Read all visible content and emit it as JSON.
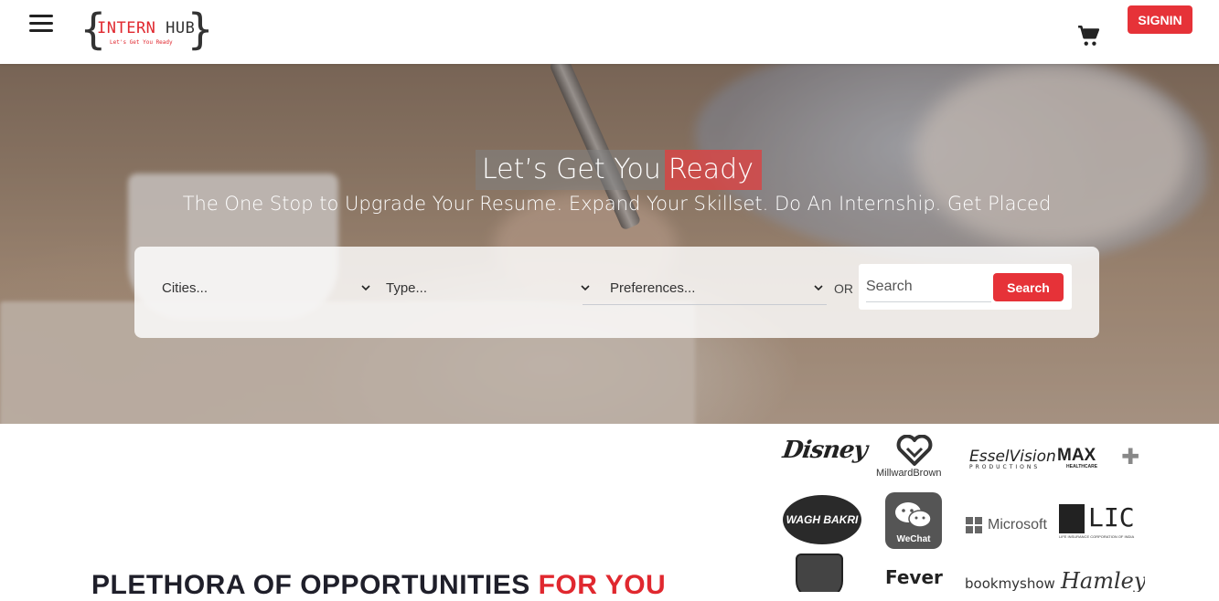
{
  "header": {
    "brand_word1": "INTERN",
    "brand_word2": "HUB",
    "brand_tagline": "Let's Get You Ready",
    "signin_label": "SIGNIN",
    "icons": {
      "menu": "hamburger-menu-icon",
      "cart": "shopping-cart-icon"
    }
  },
  "hero": {
    "title_part1": "Let’s Get You",
    "title_part2": "Ready",
    "subtitle": "The One Stop to Upgrade Your Resume. Expand Your Skillset. Do An Internship. Get Placed"
  },
  "search": {
    "cities_value": "Cities...",
    "type_value": "Type...",
    "preferences_value": "Preferences...",
    "or_label": "OR",
    "input_placeholder": "Search",
    "button_label": "Search"
  },
  "section": {
    "heading_part1": "PLETHORA OF OPPORTUNITIES",
    "heading_part2": "FOR YOU"
  },
  "partners": {
    "disney": "Disney",
    "millward": "MillwardBrown",
    "essel": "EsselVision",
    "essel_sub": "PRODUCTIONS",
    "max": "MAX",
    "max_sub": "HEALTHCARE",
    "wagh": "WAGH BAKRI",
    "wechat": "WeChat",
    "microsoft": "Microsoft",
    "lic": "LIC",
    "lic_sub": "LIFE INSURANCE CORPORATION OF INDIA",
    "porsche": "PORSCHE",
    "fever": "Fever",
    "bms": "bookmyshow",
    "hamleys": "Hamleys"
  },
  "colors": {
    "accent": "#e63238",
    "heading": "#1f1f2a"
  }
}
